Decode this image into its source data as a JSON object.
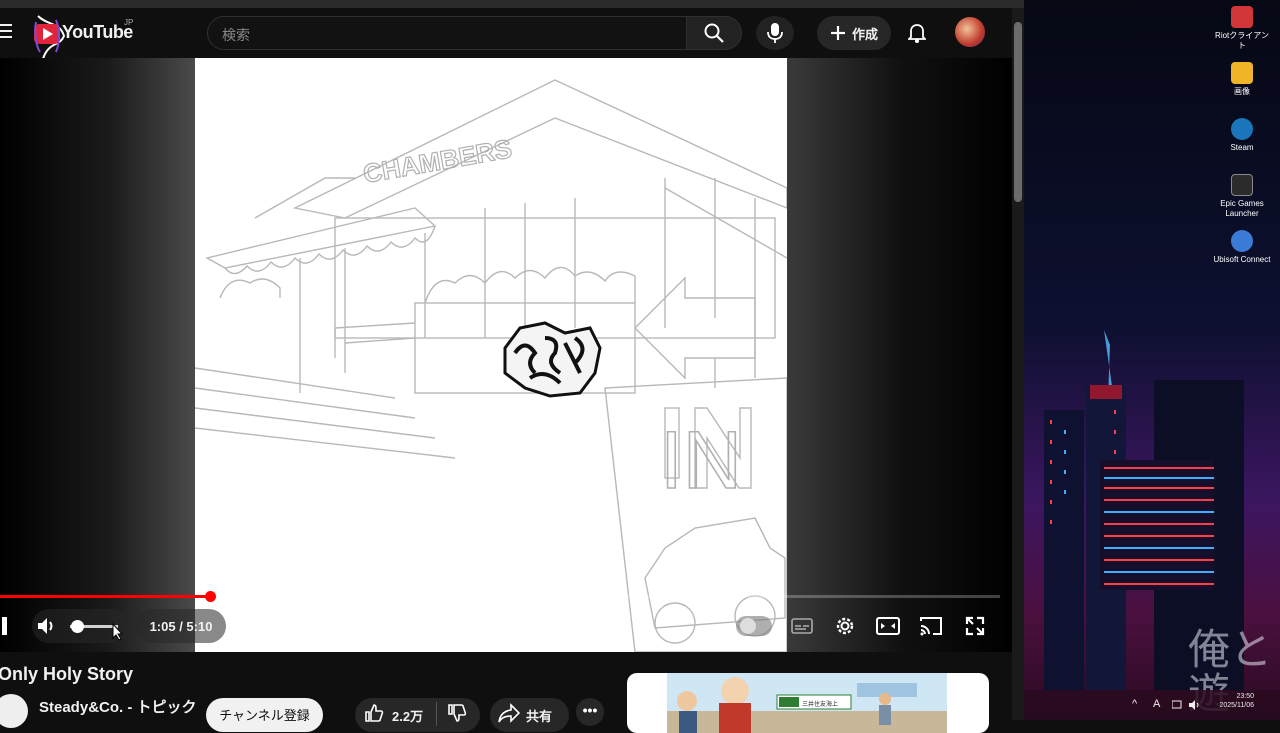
{
  "masthead": {
    "logo_text": "YouTube",
    "region": "JP",
    "search_placeholder": "検索",
    "create_label": "作成"
  },
  "player": {
    "time": "1:05 / 5:10",
    "progress_fraction": 0.21,
    "buffer_fraction": 0.44,
    "volume_level": 0.1,
    "artwork": {
      "sign_text": "CHAMBERS",
      "board_text": "IN"
    }
  },
  "video": {
    "title": "Only Holy Story",
    "channel": "Steady&Co. - トピック",
    "subscribe_label": "チャンネル登録",
    "likes": "2.2万",
    "share_label": "共有",
    "more_label": "•••"
  },
  "ad": {
    "brand_text": "三井住友海上"
  },
  "desktop": {
    "icons": [
      {
        "label": "Riotクライアント",
        "color": "#d13639"
      },
      {
        "label": "画像",
        "color": "#f0b429"
      },
      {
        "label": "Steam",
        "color": "#1b75bb"
      },
      {
        "label": "Epic Games Launcher",
        "color": "#2b2b2b"
      },
      {
        "label": "Ubisoft Connect",
        "color": "#3a7bd5"
      }
    ],
    "watermark": "俺と遊",
    "taskbar": {
      "ime": "A",
      "clock_time": "23:50",
      "clock_date": "2025/11/06"
    }
  }
}
